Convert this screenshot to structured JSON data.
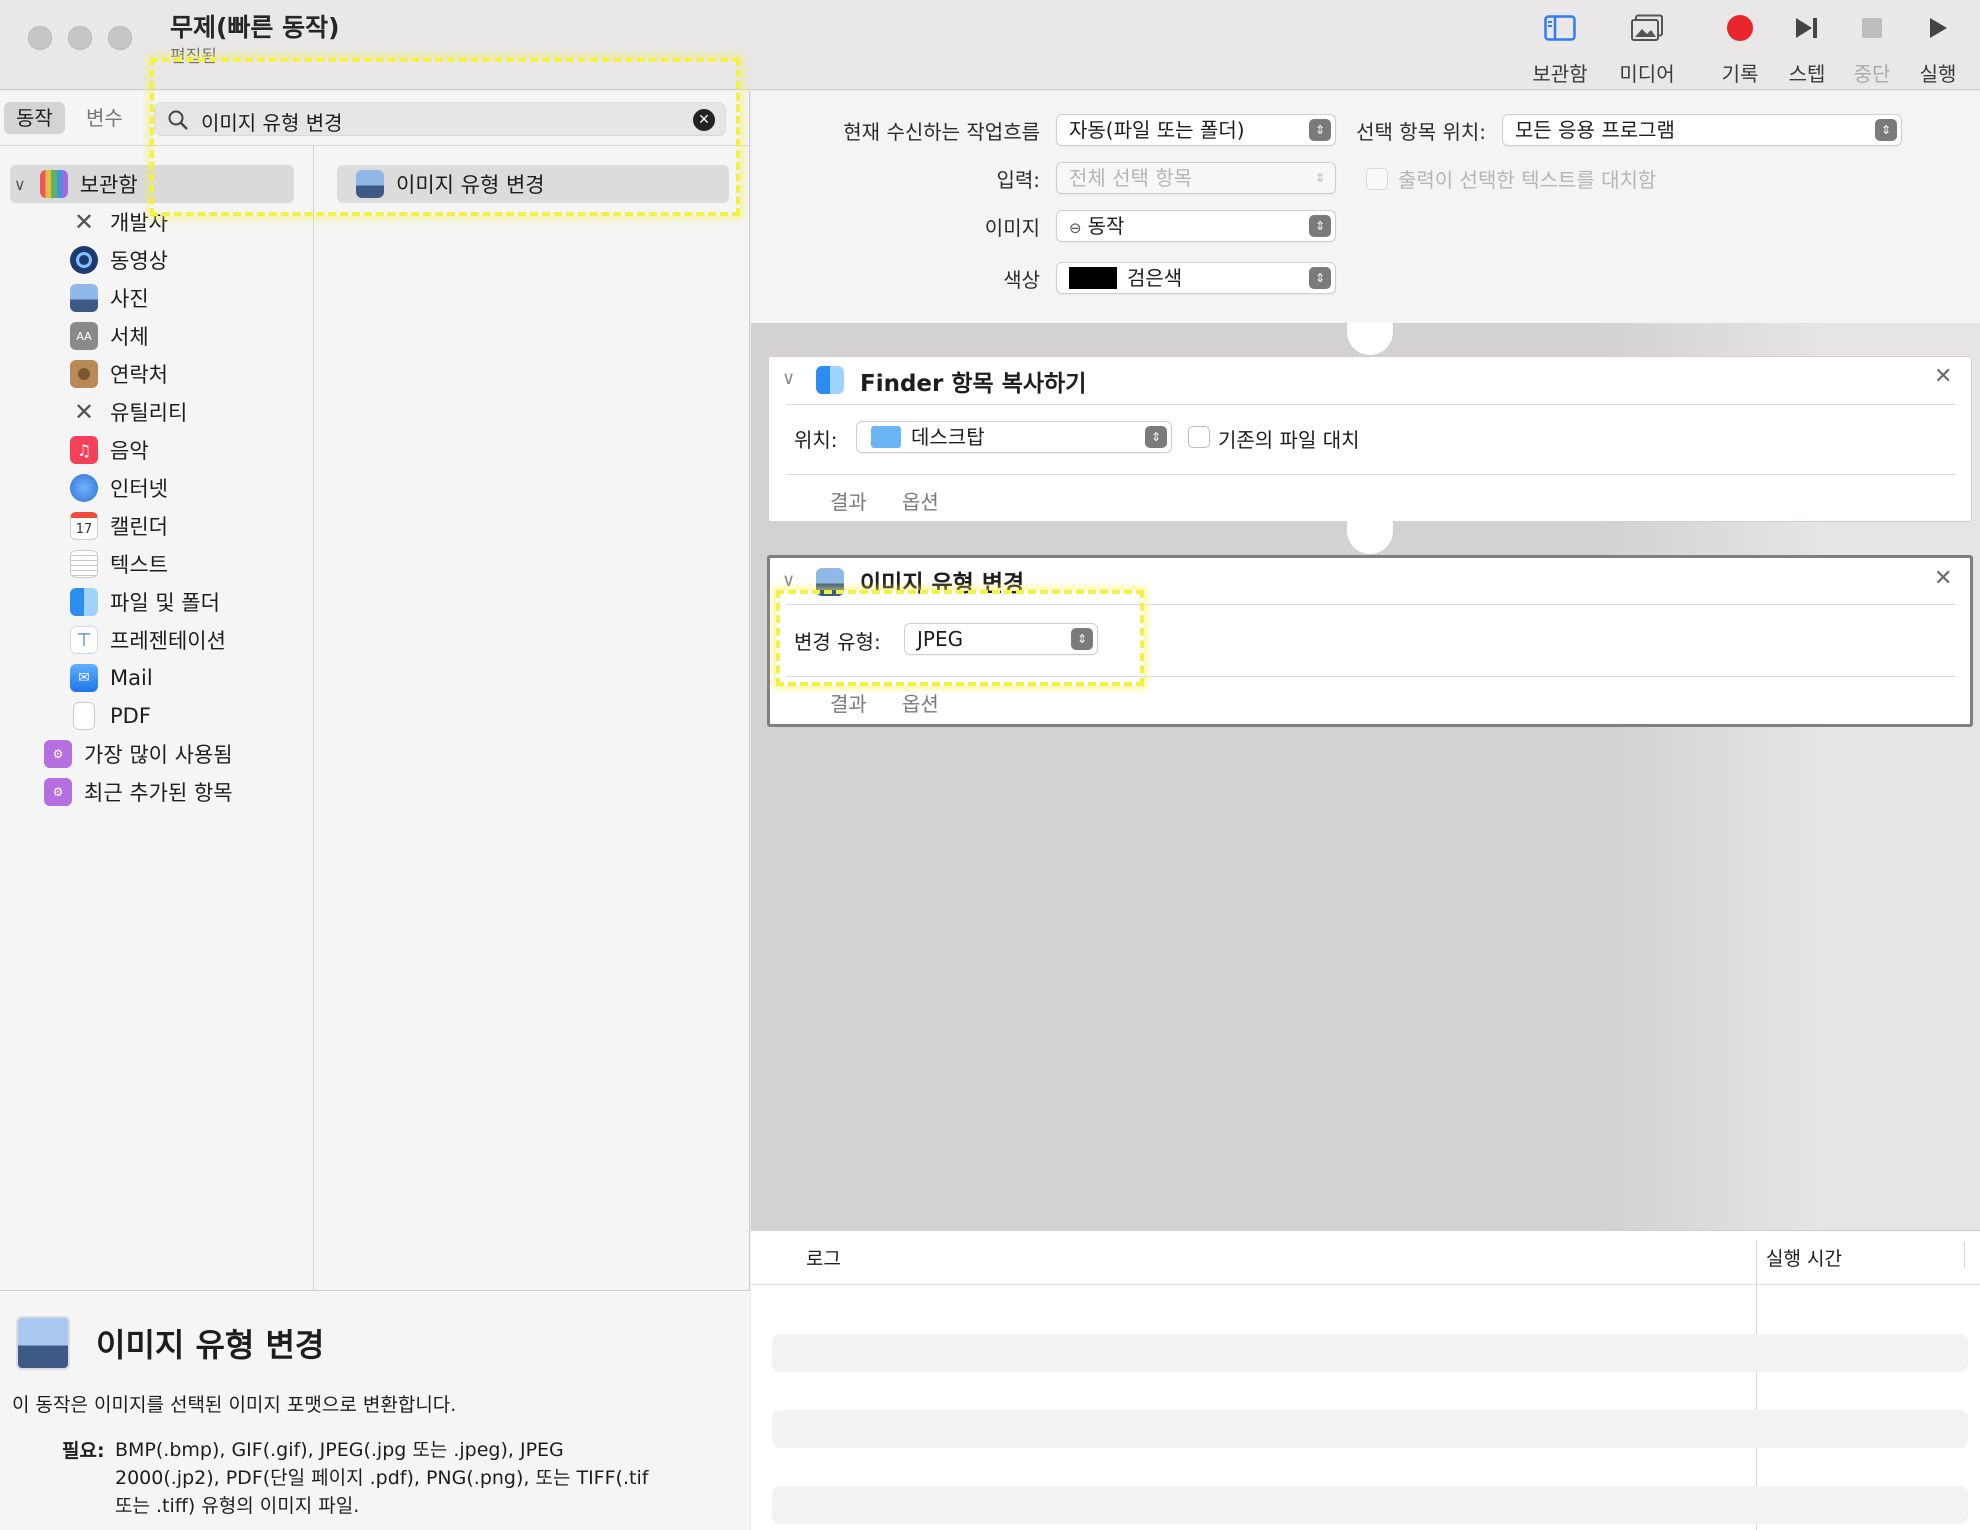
{
  "window": {
    "title": "무제(빠른 동작)",
    "subtitle": "편집됨"
  },
  "toolbar": {
    "library": "보관함",
    "media": "미디어",
    "record": "기록",
    "step": "스텝",
    "stop": "중단",
    "run": "실행",
    "record_color": "#e8262c"
  },
  "left": {
    "segment": {
      "actions": "동작",
      "variables": "변수"
    },
    "search": {
      "value": "이미지 유형 변경"
    },
    "library": [
      {
        "label": "보관함",
        "icon": "library-icon"
      },
      {
        "label": "개발자",
        "icon": "tools-icon"
      },
      {
        "label": "동영상",
        "icon": "quicktime-icon"
      },
      {
        "label": "사진",
        "icon": "preview-icon"
      },
      {
        "label": "서체",
        "icon": "fontbook-icon"
      },
      {
        "label": "연락처",
        "icon": "contacts-icon"
      },
      {
        "label": "유틸리티",
        "icon": "tools-icon"
      },
      {
        "label": "음악",
        "icon": "music-icon"
      },
      {
        "label": "인터넷",
        "icon": "globe-icon"
      },
      {
        "label": "캘린더",
        "icon": "calendar-icon"
      },
      {
        "label": "텍스트",
        "icon": "textedit-icon"
      },
      {
        "label": "파일 및 폴더",
        "icon": "finder-icon"
      },
      {
        "label": "프레젠테이션",
        "icon": "keynote-icon"
      },
      {
        "label": "Mail",
        "icon": "mail-icon"
      },
      {
        "label": "PDF",
        "icon": "pdf-icon"
      },
      {
        "label": "가장 많이 사용됨",
        "icon": "smart-folder-icon"
      },
      {
        "label": "최근 추가된 항목",
        "icon": "smart-folder-icon"
      }
    ],
    "calendar_day": "17",
    "results": [
      {
        "label": "이미지 유형 변경"
      }
    ],
    "description": {
      "title": "이미지 유형 변경",
      "body": "이 동작은 이미지를 선택된 이미지 포맷으로 변환합니다.",
      "requires_label": "필요:",
      "requires_line1": "BMP(.bmp), GIF(.gif), JPEG(.jpg 또는 .jpeg), JPEG",
      "requires_line2": "2000(.jp2), PDF(단일 페이지 .pdf), PNG(.png), 또는 TIFF(.tif",
      "requires_line3": "또는 .tiff) 유형의 이미지 파일."
    }
  },
  "workflow": {
    "receives_label": "현재 수신하는 작업흐름",
    "receives_value": "자동(파일 또는 폴더)",
    "in_label": "선택 항목 위치:",
    "in_value": "모든 응용 프로그램",
    "input_label": "입력:",
    "input_value": "전체 선택 항목",
    "replace_label": "출력이 선택한 텍스트를 대치함",
    "image_label": "이미지",
    "image_value": "동작",
    "color_label": "색상",
    "color_value": "검은색",
    "color_swatch": "#000000"
  },
  "actions": [
    {
      "title": "Finder 항목 복사하기",
      "to_label": "위치:",
      "to_value": "데스크탑",
      "replace_label": "기존의 파일 대치",
      "tab_results": "결과",
      "tab_options": "옵션"
    },
    {
      "title": "이미지 유형 변경",
      "type_label": "변경 유형:",
      "type_value": "JPEG",
      "tab_results": "결과",
      "tab_options": "옵션"
    }
  ],
  "log": {
    "col_log": "로그",
    "col_duration": "실행 시간"
  },
  "highlight_color": "#f3f046"
}
